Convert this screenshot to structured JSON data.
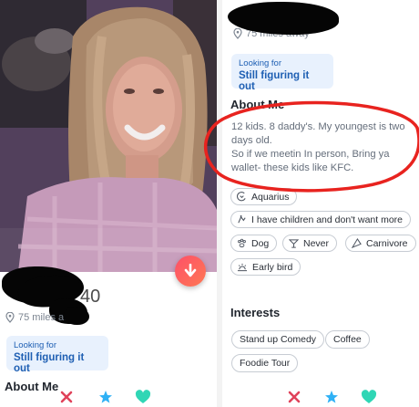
{
  "left": {
    "profile": {
      "age": "40",
      "distance": "75 miles away"
    },
    "looking_for": {
      "label": "Looking for",
      "value": "Still figuring it out"
    },
    "about_heading": "About Me"
  },
  "right": {
    "distance": "75 miles away",
    "looking_for": {
      "label": "Looking for",
      "value": "Still figuring it out"
    },
    "about": {
      "heading": "About Me",
      "line1": "12 kids. 8 daddy's. My youngest is two days old.",
      "line2": "So if we meetin In person, Bring ya wallet- these kids like KFC."
    },
    "basics": [
      {
        "icon": "zodiac-icon",
        "label": "Aquarius"
      },
      {
        "icon": "family-icon",
        "label": "I have children and don't want more"
      },
      {
        "icon": "paw-icon",
        "label": "Dog"
      },
      {
        "icon": "drink-icon",
        "label": "Never"
      },
      {
        "icon": "food-icon",
        "label": "Carnivore"
      },
      {
        "icon": "sleep-icon",
        "label": "Early bird"
      }
    ],
    "interests": {
      "heading": "Interests",
      "items": [
        "Stand up Comedy",
        "Coffee",
        "Foodie Tour"
      ]
    }
  },
  "actions": [
    "nope-icon",
    "super-like-icon",
    "like-icon"
  ],
  "colors": {
    "accent_blue": "#1e5fb3",
    "looking_bg": "#e8f1fd",
    "nope": "#e0425a",
    "super_like": "#2fb1f5",
    "like": "#30d6b5",
    "annotation": "#e8231f"
  }
}
